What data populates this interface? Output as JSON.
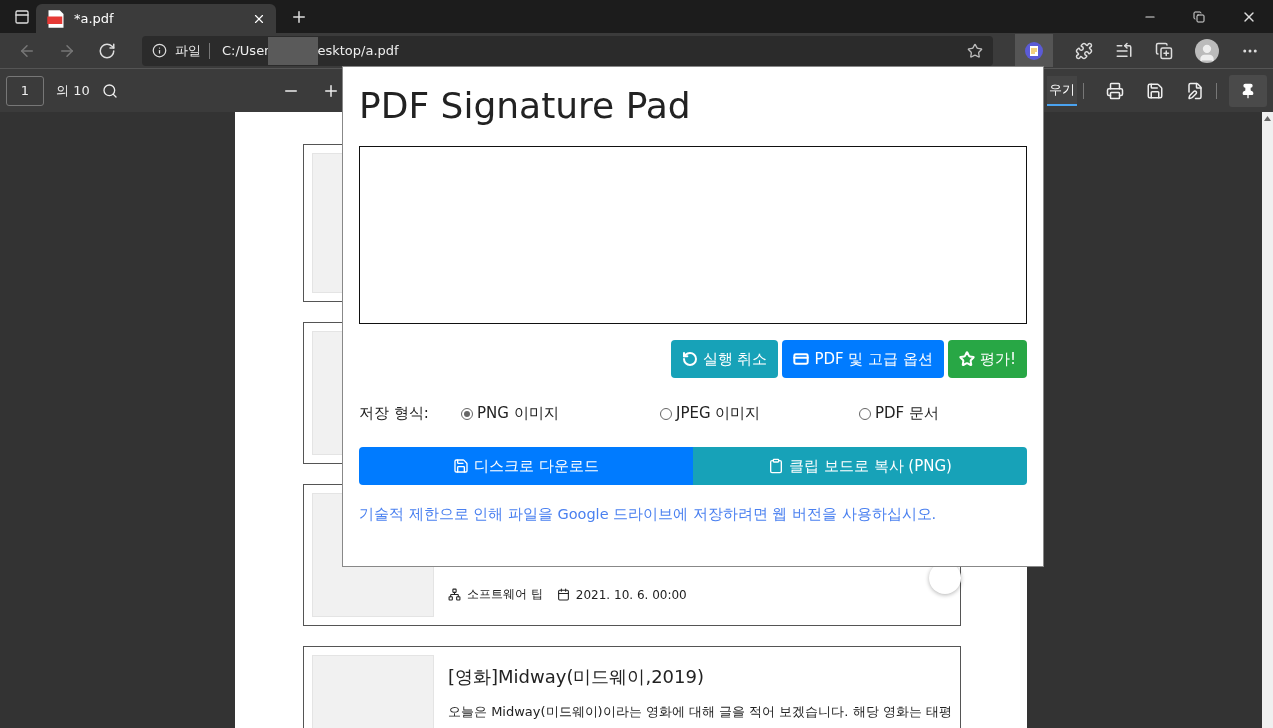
{
  "browser": {
    "tabs": [
      {
        "title": "*a.pdf",
        "selected": true
      }
    ],
    "address": {
      "scheme": "파일",
      "url_start": "C:/User",
      "url_end": "esktop/a.pdf"
    }
  },
  "pdf_toolbar": {
    "page": "1",
    "page_count": "의 10",
    "partial_tab": {
      "label": "우기",
      "selected": true
    }
  },
  "document": {
    "cards": [
      {
        "kind": "empty"
      },
      {
        "kind": "empty"
      },
      {
        "kind": "meta",
        "category": "소프트웨어 팁",
        "date": "2021. 10. 6. 00:00"
      },
      {
        "kind": "post",
        "title": "[영화]Midway(미드웨이,2019)",
        "body": [
          "오늘은 Midway(미드웨이)이라는 영화에 대해 글을 적어 보겠습니다. 해당 영화는 태평"
        ]
      }
    ]
  },
  "popup": {
    "title": "PDF Signature Pad",
    "actions": [
      {
        "kind": "undo",
        "label": "실행 취소"
      },
      {
        "kind": "options",
        "label": "PDF 및 고급 옵션"
      },
      {
        "kind": "rate",
        "label": "평가!"
      }
    ],
    "format_label": "저장 형식:",
    "formats": [
      {
        "label": "PNG 이미지",
        "selected": true
      },
      {
        "label": "JPEG 이미지",
        "selected": false
      },
      {
        "label": "PDF 문서",
        "selected": false
      }
    ],
    "outputs": [
      {
        "kind": "download",
        "label": "디스크로 다운로드"
      },
      {
        "kind": "copy",
        "label": "클립 보드로 복사 (PNG)"
      }
    ],
    "note": "기술적 제한으로 인해 파일을 Google 드라이브에 저장하려면 웹 버전을 사용하십시오."
  }
}
